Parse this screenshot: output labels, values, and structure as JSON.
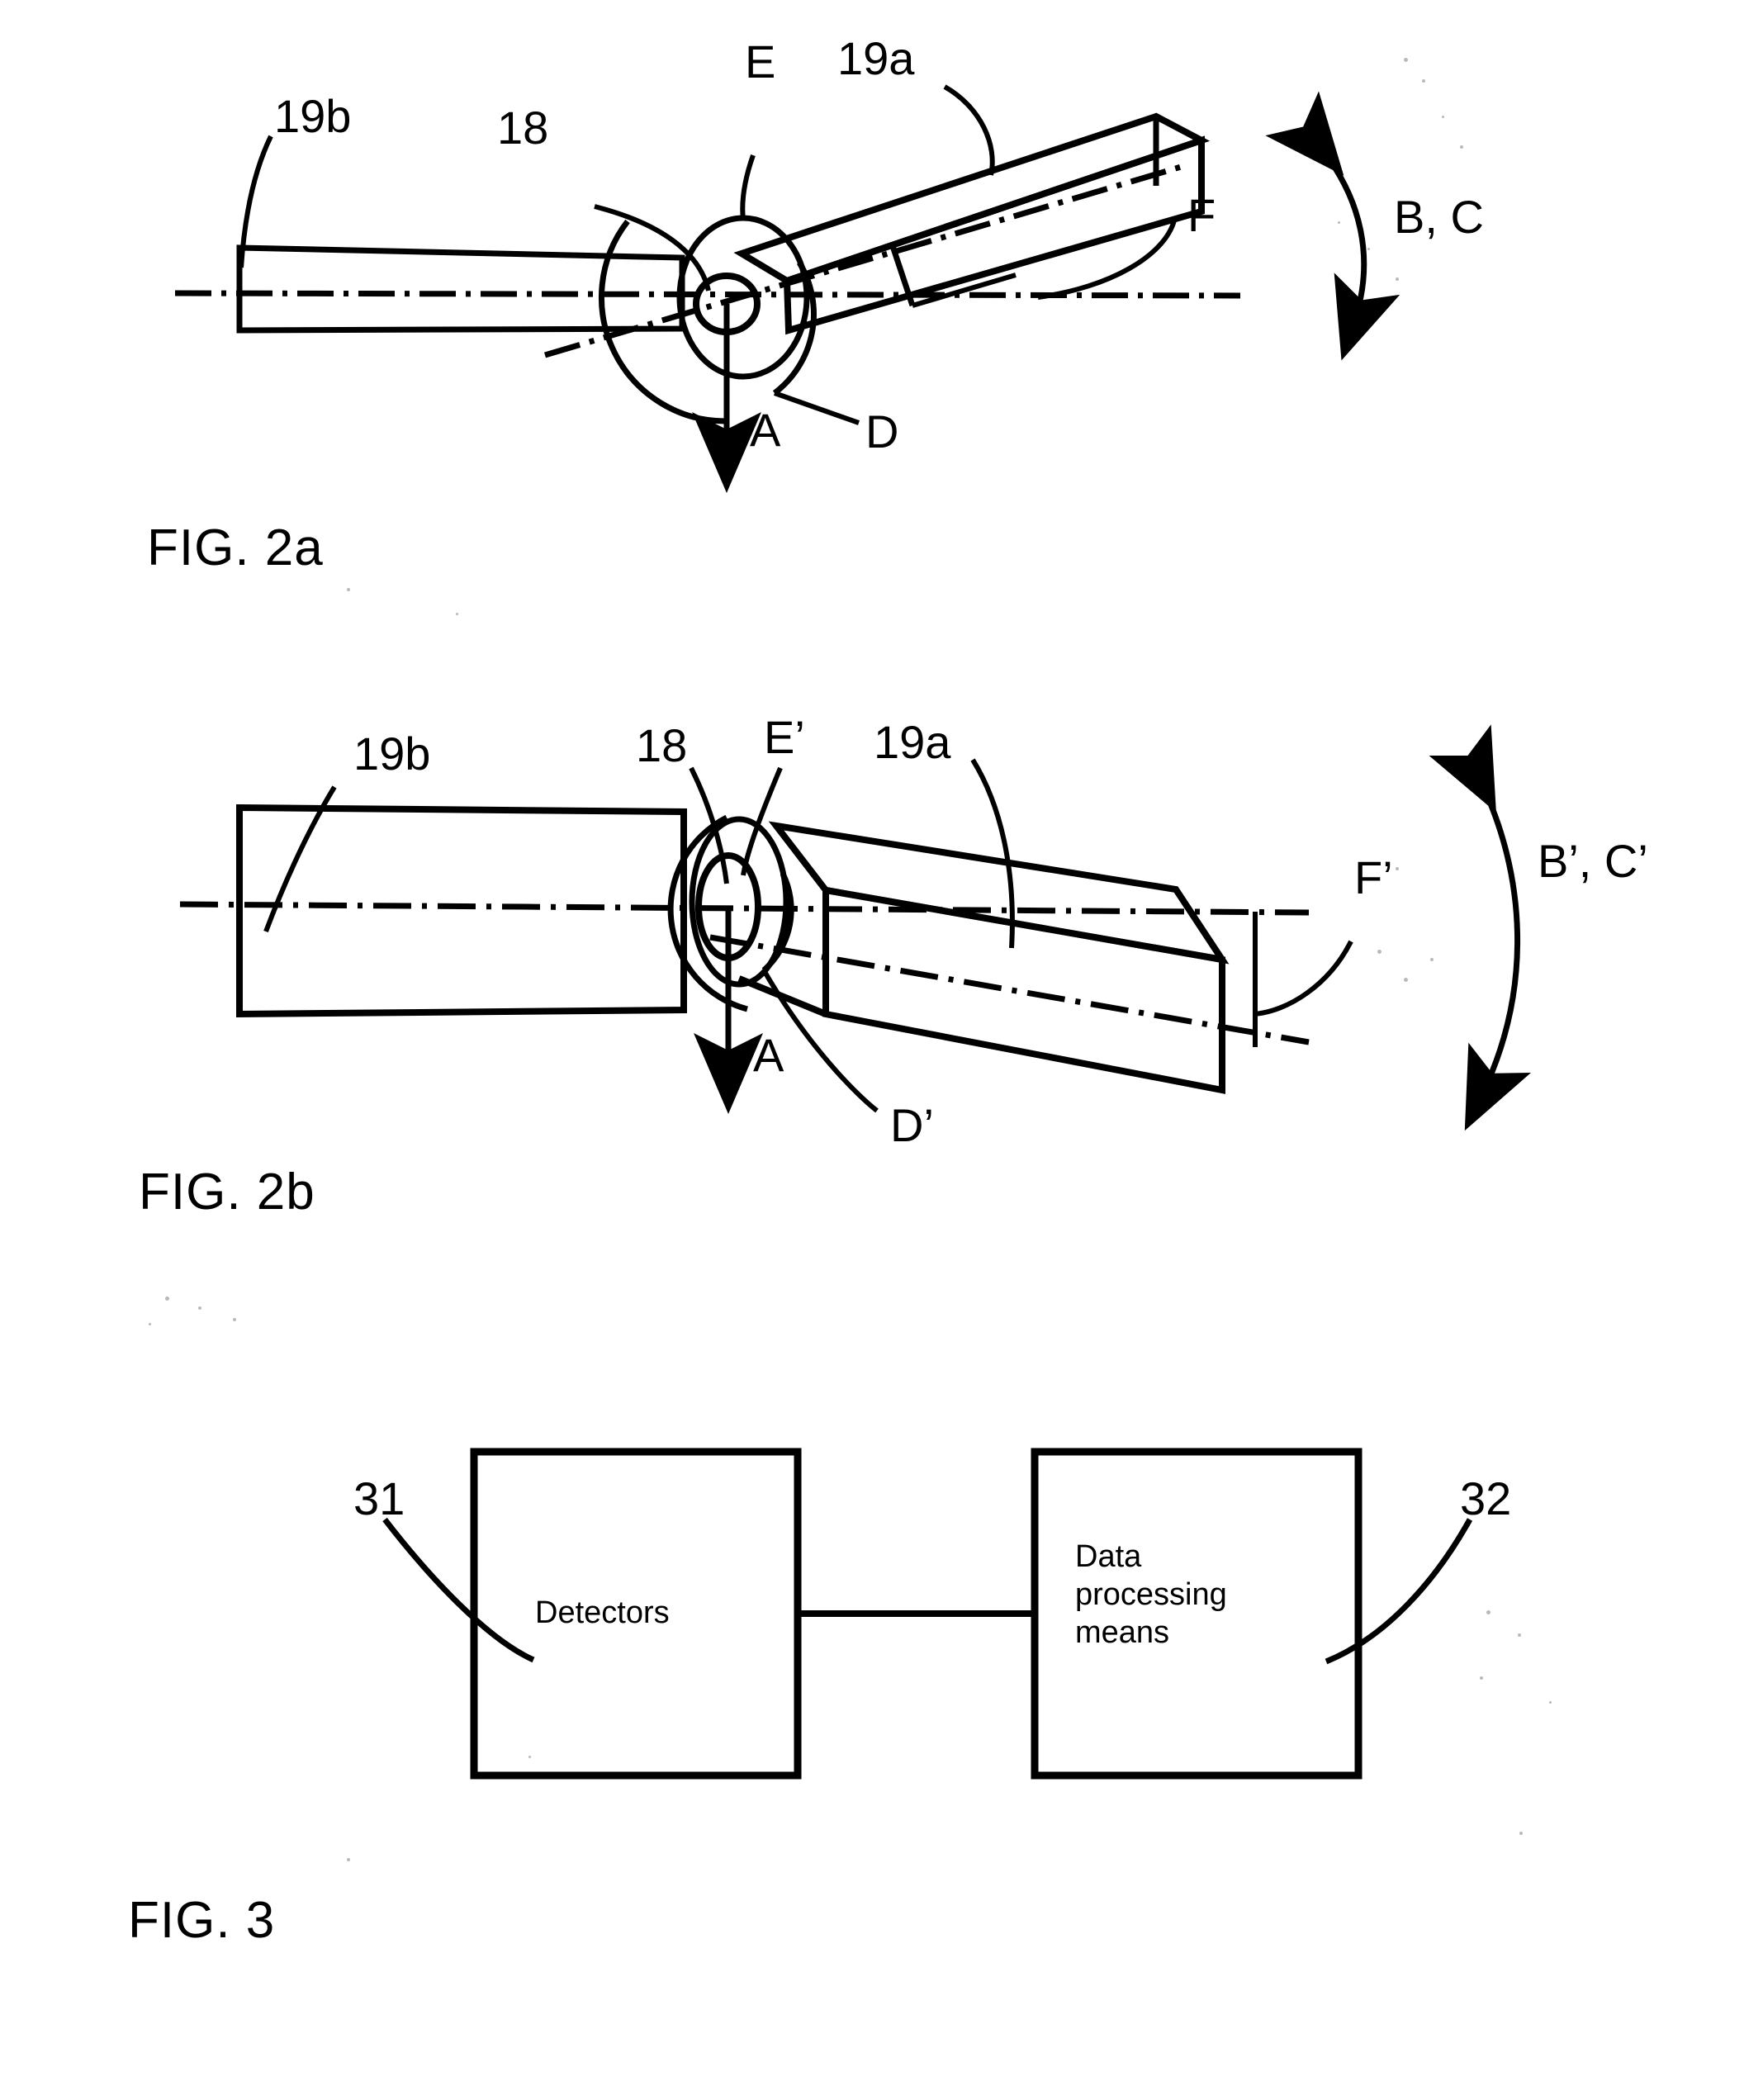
{
  "document": {
    "kind": "patent-drawing-sheet",
    "background_color": "#ffffff",
    "line_color": "#000000"
  },
  "figures": [
    {
      "id": "fig-2a",
      "caption": "FIG. 2a",
      "labels": {
        "part_19b": "19b",
        "part_18": "18",
        "point_E": "E",
        "part_19a": "19a",
        "point_F": "F",
        "axis_A": "A",
        "angle_D": "D",
        "rotation_BC": "B, C"
      }
    },
    {
      "id": "fig-2b",
      "caption": "FIG. 2b",
      "labels": {
        "part_19b": "19b",
        "part_18": "18",
        "point_E_prime": "E’",
        "part_19a": "19a",
        "point_F_prime": "F’",
        "axis_A": "A",
        "angle_D_prime": "D’",
        "rotation_BC_prime": "B’, C’"
      }
    },
    {
      "id": "fig-3",
      "caption": "FIG. 3",
      "blocks": [
        {
          "ref": "31",
          "title": "Detectors"
        },
        {
          "ref": "32",
          "title": "Data\nprocessing\nmeans"
        }
      ],
      "connector": "solid-line"
    }
  ]
}
